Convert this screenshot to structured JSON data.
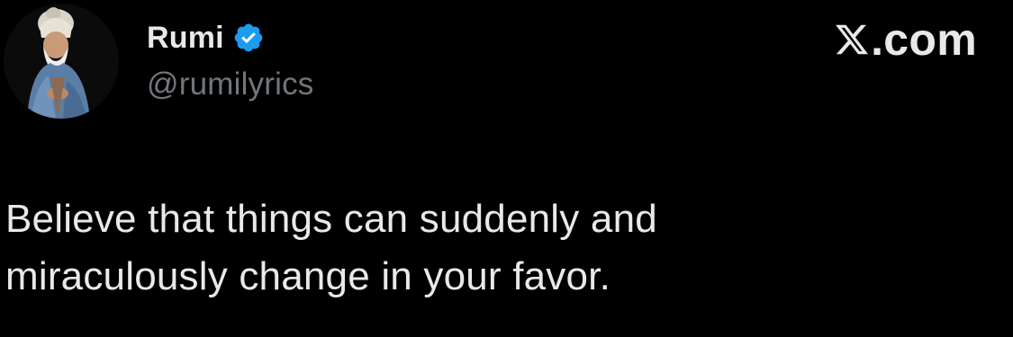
{
  "author": {
    "display_name": "Rumi",
    "handle": "@rumilyrics",
    "verified": true,
    "avatar_icon": "avatar-image"
  },
  "brand": {
    "icon": "x-logo-icon",
    "text": ".com"
  },
  "tweet": {
    "lines": [
      "Believe that things can suddenly and",
      "miraculously change in your favor."
    ]
  },
  "colors": {
    "background": "#000000",
    "text_primary": "#e7e9ea",
    "text_secondary": "#71767b",
    "verified_blue": "#1d9bf0"
  }
}
